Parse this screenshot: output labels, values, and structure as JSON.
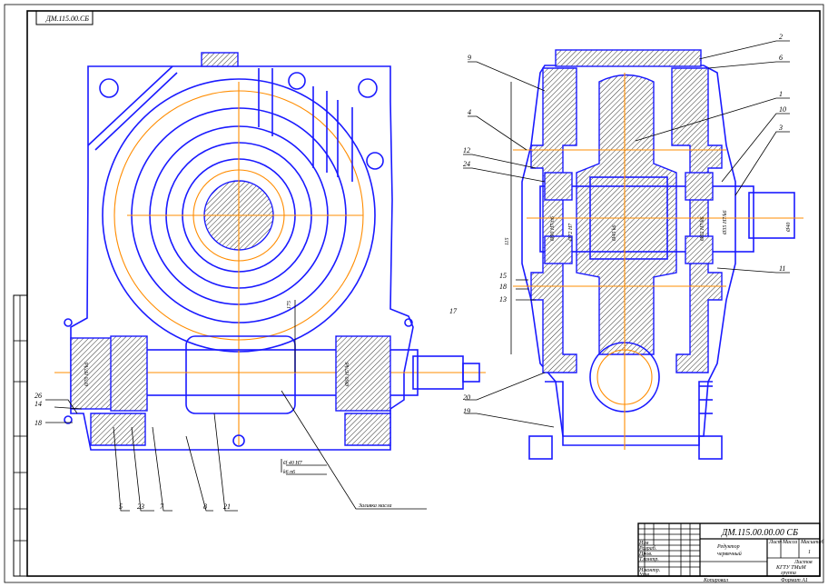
{
  "drawing": {
    "stamp_top": "ДМ.115.00.СБ",
    "title_block": {
      "designation": "ДМ.115.00.00.00 СБ",
      "name_line1": "Редуктор",
      "name_line2": "червячный",
      "sheet_label": "Лист",
      "mass_label": "Масса",
      "scale_label": "Масштаб",
      "scale_value": "1",
      "sheets_label": "Листов",
      "org_line1": "КГТУ ТМиМ",
      "org_line2": "группа",
      "roles": [
        "Изм",
        "Разраб.",
        "Пров.",
        "Т.контр.",
        "Н.контр.",
        "Утв."
      ],
      "copied": "Копировал",
      "format": "Формат А1"
    },
    "front_view_labels": [
      "5",
      "23",
      "7",
      "8",
      "21",
      "26",
      "14",
      "18"
    ],
    "front_view_notes": {
      "note1": "Ø 40 H7",
      "note2": "k6  n6",
      "lead_text": "Заливка масла"
    },
    "side_view_labels": [
      "2",
      "6",
      "9",
      "4",
      "1",
      "10",
      "3",
      "12",
      "24",
      "15",
      "18",
      "13",
      "11",
      "20",
      "19",
      "17"
    ],
    "dims": [
      "Ø70 H7/k6",
      "Ø60 H7/k6",
      "Ø90 H7/n6",
      "Ø45 k6",
      "Ø62 H7/k6",
      "Ø35 H7/k6",
      "Ø72 H7",
      "Ø40",
      "175",
      "115"
    ]
  }
}
